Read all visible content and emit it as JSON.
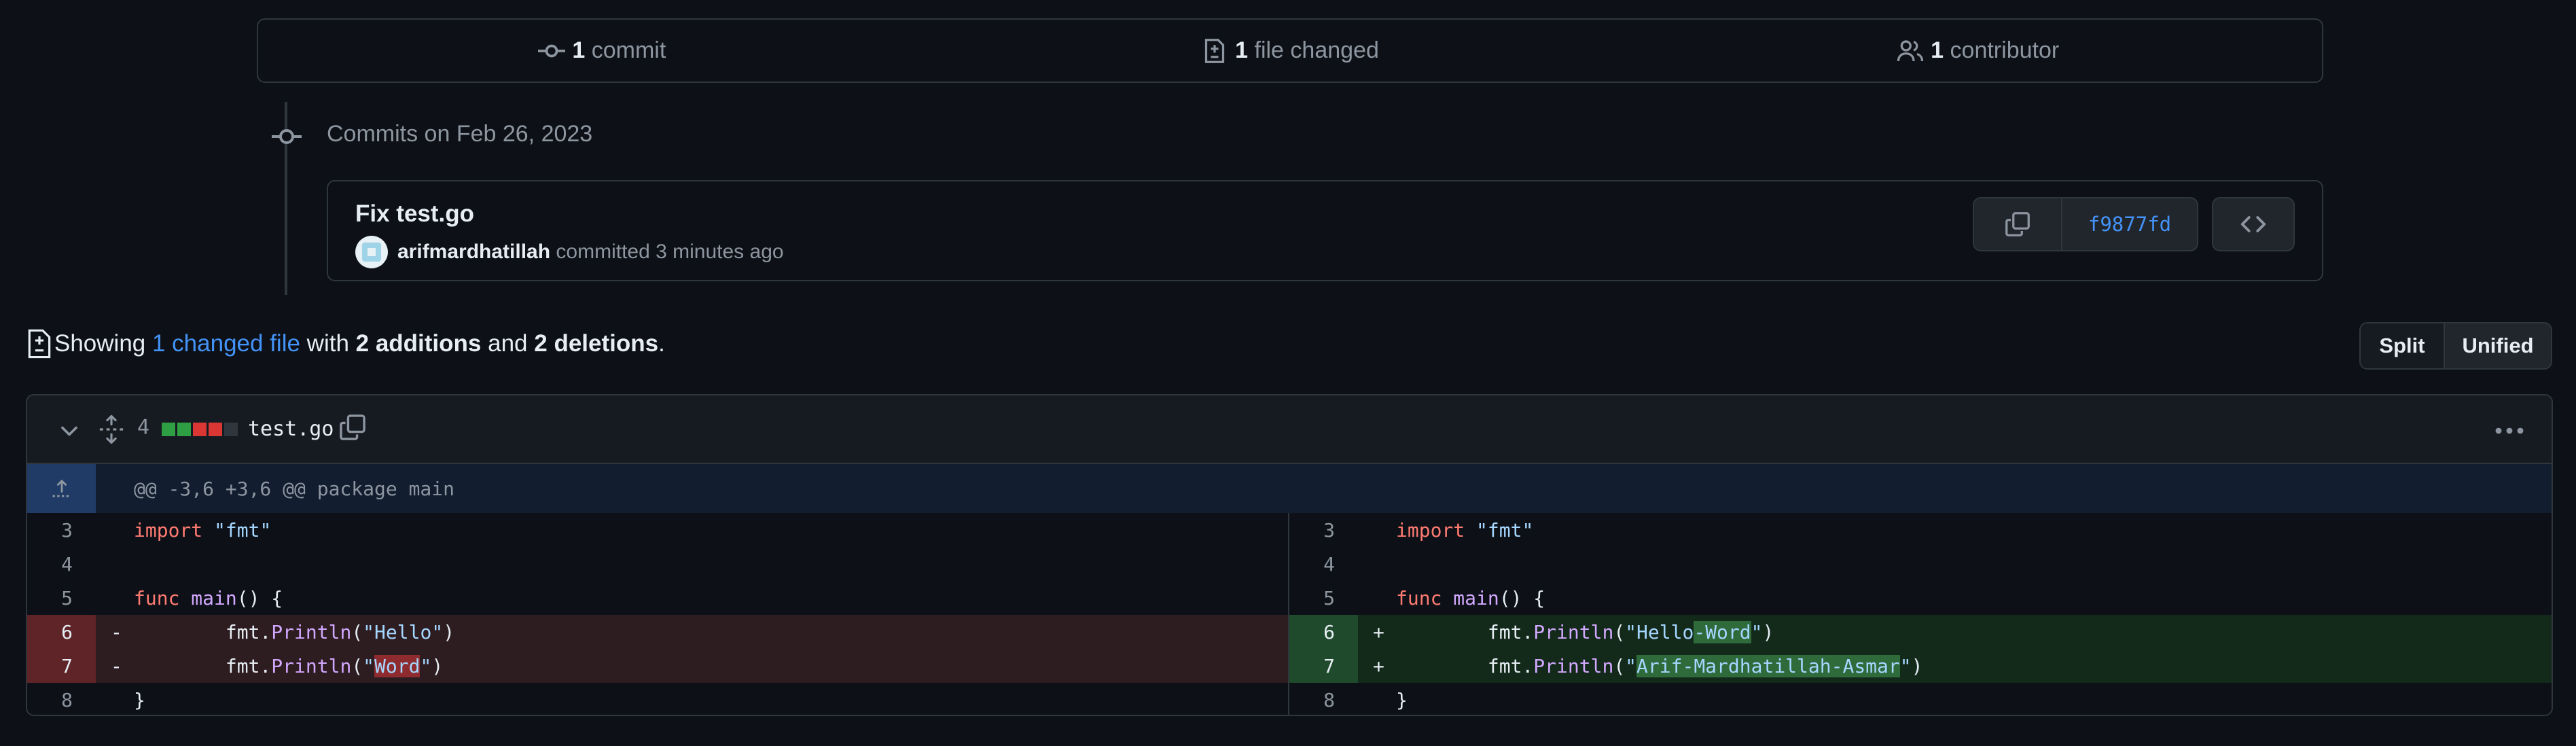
{
  "summary": {
    "commit_count": "1",
    "commit_label": "commit",
    "files_count": "1",
    "files_label": "file changed",
    "contributor_count": "1",
    "contributor_label": "contributor"
  },
  "timeline": {
    "date_label": "Commits on Feb 26, 2023"
  },
  "commit": {
    "title": "Fix test.go",
    "author": "arifmardhatillah",
    "meta": "committed 3 minutes ago",
    "sha": "f9877fd"
  },
  "showing": {
    "prefix": "Showing ",
    "changed_link": "1 changed file",
    "with": " with ",
    "additions": "2 additions",
    "and": " and ",
    "deletions": "2 deletions",
    "suffix": "."
  },
  "view_toggle": {
    "split": "Split",
    "unified": "Unified"
  },
  "file": {
    "change_count": "4",
    "name": "test.go",
    "hunk_header": "@@ -3,6 +3,6 @@ package main"
  },
  "diff": {
    "left": {
      "line_numbers": [
        "3",
        "4",
        "5",
        "6",
        "7",
        "8"
      ],
      "markers": [
        "",
        "",
        "",
        "-",
        "-",
        ""
      ]
    },
    "right": {
      "line_numbers": [
        "3",
        "4",
        "5",
        "6",
        "7",
        "8"
      ],
      "markers": [
        "",
        "",
        "",
        "+",
        "+",
        ""
      ]
    },
    "tokens": {
      "import": "import",
      "fmt_str": "\"fmt\"",
      "func": "func",
      "main": "main",
      "main_sig": "() {",
      "indent": "        ",
      "fmt_pkg": "fmt.",
      "println": "Println",
      "open": "(\"",
      "close": "\")",
      "hello": "Hello",
      "word": "Word",
      "hello_word_sep": "-",
      "arif": "Arif-Mardhatillah-Asmar",
      "brace_close": "}"
    }
  },
  "colors": {
    "accent": "#4493f8",
    "addition": "#2ea043",
    "deletion": "#da3633"
  },
  "icons": [
    "commit-icon",
    "file-diff-icon",
    "people-icon",
    "copy-icon",
    "code-icon",
    "chevron-down-icon",
    "unfold-icon",
    "kebab-horizontal-icon",
    "fold-up-icon"
  ]
}
